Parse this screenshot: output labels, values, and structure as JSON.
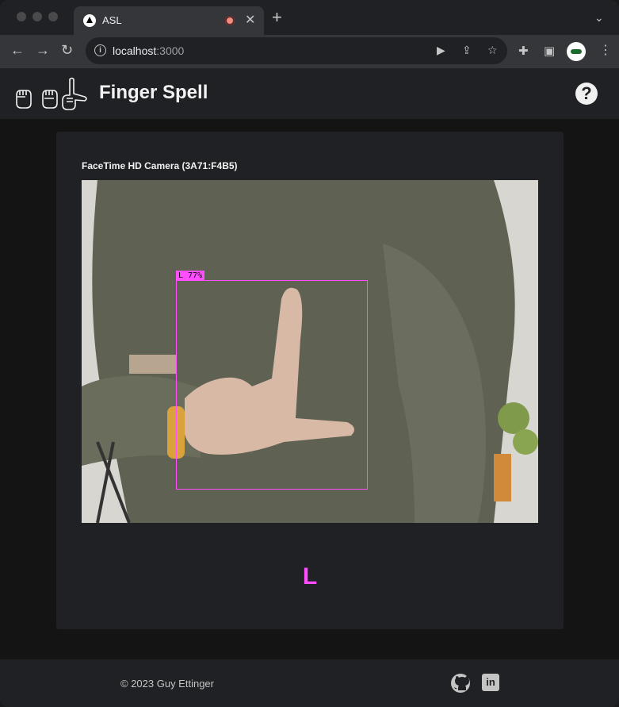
{
  "browser": {
    "tab_title": "ASL",
    "new_tab": "+",
    "close_tab": "✕",
    "url_host": "localhost",
    "url_port": ":3000",
    "icons": [
      "back-icon",
      "forward-icon",
      "reload-icon",
      "info-icon",
      "camera-icon",
      "share-icon",
      "star-icon",
      "extensions-icon",
      "sidepanel-icon",
      "profile-avatar",
      "menu-icon"
    ]
  },
  "header": {
    "title": "Finger Spell",
    "help_label": "?"
  },
  "camera": {
    "label": "FaceTime HD Camera (3A71:F4B5)"
  },
  "detection": {
    "label": "L 77%",
    "color": "#ff4dff"
  },
  "prediction": {
    "letter": "L"
  },
  "footer": {
    "copyright": "© 2023 Guy Ettinger",
    "linkedin_glyph": "in"
  }
}
